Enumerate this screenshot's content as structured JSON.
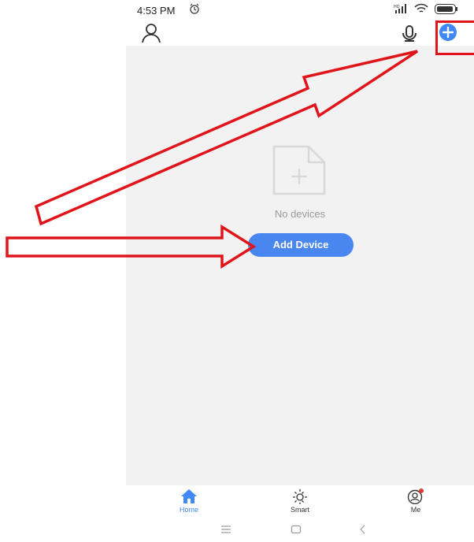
{
  "status_bar": {
    "time": "4:53 PM",
    "icons": [
      "alarm-icon",
      "signal-icon",
      "wifi-icon",
      "battery-icon"
    ]
  },
  "header": {
    "icons": [
      "profile-icon",
      "microphone-icon",
      "add-icon"
    ]
  },
  "main": {
    "empty_message": "No devices",
    "add_device_label": "Add Device"
  },
  "bottom_nav": {
    "items": [
      {
        "label": "Home",
        "icon": "home-icon",
        "active": true
      },
      {
        "label": "Smart",
        "icon": "sun-icon",
        "active": false
      },
      {
        "label": "Me",
        "icon": "user-circle-icon",
        "active": false,
        "badge": true
      }
    ]
  },
  "system_nav": {
    "icons": [
      "menu-icon",
      "home-square-icon",
      "back-icon"
    ]
  },
  "colors": {
    "accent": "#3f88f5",
    "background": "#f2f2f2",
    "annotation": "#e0151b"
  }
}
